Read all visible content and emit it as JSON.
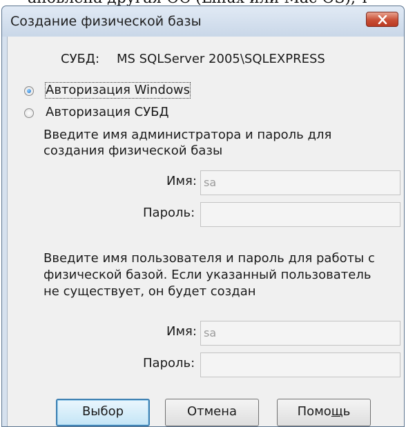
{
  "background_text": "ановлена другая ОС (Linux или Mac OS), т",
  "dialog": {
    "title": "Создание физической базы",
    "dbms_label": "СУБД:",
    "dbms_value": "MS SQLServer 2005\\SQLEXPRESS",
    "radio_windows": "Авторизация Windows",
    "radio_dbms": "Авторизация СУБД",
    "selected_auth": "windows",
    "admin_prompt_line1": "Введите имя администратора и пароль для",
    "admin_prompt_line2": "создания физической базы",
    "admin_name_label": "Имя:",
    "admin_name_value": "sa",
    "admin_password_label": "Пароль:",
    "admin_password_value": "",
    "user_prompt_line1": "Введите имя пользователя и пароль для работы с",
    "user_prompt_line2": "физической базой. Если указанный пользователь",
    "user_prompt_line3": "не существует, он будет создан",
    "user_name_label": "Имя:",
    "user_name_value": "sa",
    "user_password_label": "Пароль:",
    "user_password_value": "",
    "button_select": "Выбор",
    "button_cancel": "Отмена",
    "button_help_prefix": "Помо",
    "button_help_underlined": "щ",
    "button_help_suffix": "ь"
  },
  "colors": {
    "titlebar": "#d6e1ee",
    "client_bg": "#f0f0f0",
    "close_button": "#c94f36",
    "default_button_border": "#3c7fb1"
  }
}
